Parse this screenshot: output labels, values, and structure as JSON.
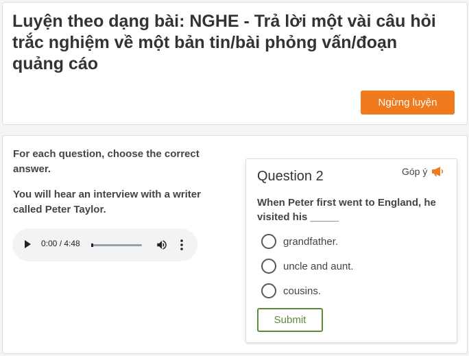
{
  "header": {
    "title": "Luyện theo dạng bài: NGHE - Trả lời một vài câu hỏi trắc nghiệm về một bản tin/bài phỏng vấn/đoạn quảng cáo",
    "stop_label": "Ngừng luyện"
  },
  "instructions": {
    "line1": "For each question, choose the correct answer.",
    "line2": "You will hear an interview with a writer called Peter Taylor."
  },
  "audio": {
    "time": "0:00 / 4:48",
    "progress": 0
  },
  "question": {
    "title": "Question 2",
    "feedback_label": "Góp ý",
    "text": "When Peter first went to England, he visited his _____",
    "options": [
      {
        "label": "grandfather."
      },
      {
        "label": "uncle and aunt."
      },
      {
        "label": "cousins."
      }
    ],
    "submit_label": "Submit"
  },
  "colors": {
    "accent": "#f07a1e",
    "submit": "#5b8a3c"
  }
}
